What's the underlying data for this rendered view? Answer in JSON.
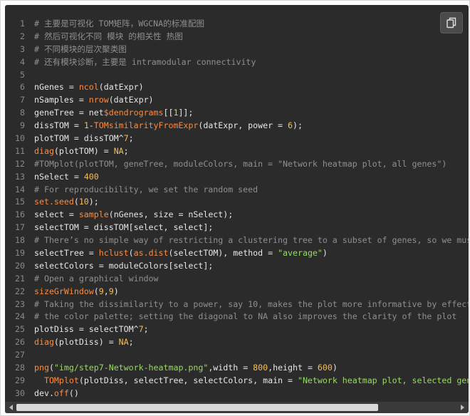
{
  "toolbar": {
    "copy_icon": "copy-icon"
  },
  "code": {
    "lines": [
      {
        "n": "1",
        "t": [
          {
            "c": "c",
            "v": "# 主要是可视化 TOM矩阵，WGCNA的标准配图"
          }
        ]
      },
      {
        "n": "2",
        "t": [
          {
            "c": "c",
            "v": "# 然后可视化不同 模块 的相关性 热图"
          }
        ]
      },
      {
        "n": "3",
        "t": [
          {
            "c": "c",
            "v": "# 不同模块的层次聚类图"
          }
        ]
      },
      {
        "n": "4",
        "t": [
          {
            "c": "c",
            "v": "# 还有模块诊断，主要是 intramodular connectivity"
          }
        ]
      },
      {
        "n": "5",
        "t": []
      },
      {
        "n": "6",
        "t": [
          {
            "c": "",
            "v": "nGenes = "
          },
          {
            "c": "f",
            "v": "ncol"
          },
          {
            "c": "",
            "v": "(datExpr)"
          }
        ]
      },
      {
        "n": "7",
        "t": [
          {
            "c": "",
            "v": "nSamples = "
          },
          {
            "c": "f",
            "v": "nrow"
          },
          {
            "c": "",
            "v": "(datExpr)"
          }
        ]
      },
      {
        "n": "8",
        "t": [
          {
            "c": "",
            "v": "geneTree = net"
          },
          {
            "c": "f",
            "v": "$dendrograms"
          },
          {
            "c": "",
            "v": "[["
          },
          {
            "c": "n",
            "v": "1"
          },
          {
            "c": "",
            "v": "]];"
          }
        ]
      },
      {
        "n": "9",
        "t": [
          {
            "c": "",
            "v": "dissTOM = "
          },
          {
            "c": "n",
            "v": "1"
          },
          {
            "c": "",
            "v": "-"
          },
          {
            "c": "f",
            "v": "TOMsimilarityFromExpr"
          },
          {
            "c": "",
            "v": "(datExpr, power = "
          },
          {
            "c": "n",
            "v": "6"
          },
          {
            "c": "",
            "v": ");"
          }
        ]
      },
      {
        "n": "10",
        "t": [
          {
            "c": "",
            "v": "plotTOM = dissTOM^"
          },
          {
            "c": "n",
            "v": "7"
          },
          {
            "c": "",
            "v": ";"
          }
        ]
      },
      {
        "n": "11",
        "t": [
          {
            "c": "f",
            "v": "diag"
          },
          {
            "c": "",
            "v": "(plotTOM) = "
          },
          {
            "c": "n",
            "v": "NA"
          },
          {
            "c": "",
            "v": ";"
          }
        ]
      },
      {
        "n": "12",
        "t": [
          {
            "c": "c",
            "v": "#TOMplot(plotTOM, geneTree, moduleColors, main = \"Network heatmap plot, all genes\")"
          }
        ]
      },
      {
        "n": "13",
        "t": [
          {
            "c": "",
            "v": "nSelect = "
          },
          {
            "c": "n",
            "v": "400"
          }
        ]
      },
      {
        "n": "14",
        "t": [
          {
            "c": "c",
            "v": "# For reproducibility, we set the random seed"
          }
        ]
      },
      {
        "n": "15",
        "t": [
          {
            "c": "f",
            "v": "set.seed"
          },
          {
            "c": "",
            "v": "("
          },
          {
            "c": "n",
            "v": "10"
          },
          {
            "c": "",
            "v": ");"
          }
        ]
      },
      {
        "n": "16",
        "t": [
          {
            "c": "",
            "v": "select = "
          },
          {
            "c": "f",
            "v": "sample"
          },
          {
            "c": "",
            "v": "(nGenes, size = nSelect);"
          }
        ]
      },
      {
        "n": "17",
        "t": [
          {
            "c": "",
            "v": "selectTOM = dissTOM[select, select];"
          }
        ]
      },
      {
        "n": "18",
        "t": [
          {
            "c": "c",
            "v": "# There’s no simple way of restricting a clustering tree to a subset of genes, so we mus"
          }
        ]
      },
      {
        "n": "19",
        "t": [
          {
            "c": "",
            "v": "selectTree = "
          },
          {
            "c": "f",
            "v": "hclust"
          },
          {
            "c": "",
            "v": "("
          },
          {
            "c": "f",
            "v": "as.dist"
          },
          {
            "c": "",
            "v": "(selectTOM), method = "
          },
          {
            "c": "s",
            "v": "\"average\""
          },
          {
            "c": "",
            "v": ")"
          }
        ]
      },
      {
        "n": "20",
        "t": [
          {
            "c": "",
            "v": "selectColors = moduleColors[select];"
          }
        ]
      },
      {
        "n": "21",
        "t": [
          {
            "c": "c",
            "v": "# Open a graphical window"
          }
        ]
      },
      {
        "n": "22",
        "t": [
          {
            "c": "f",
            "v": "sizeGrWindow"
          },
          {
            "c": "",
            "v": "("
          },
          {
            "c": "n",
            "v": "9"
          },
          {
            "c": "",
            "v": ","
          },
          {
            "c": "n",
            "v": "9"
          },
          {
            "c": "",
            "v": ")"
          }
        ]
      },
      {
        "n": "23",
        "t": [
          {
            "c": "c",
            "v": "# Taking the dissimilarity to a power, say 10, makes the plot more informative by effect"
          }
        ]
      },
      {
        "n": "24",
        "t": [
          {
            "c": "c",
            "v": "# the color palette; setting the diagonal to NA also improves the clarity of the plot"
          }
        ]
      },
      {
        "n": "25",
        "t": [
          {
            "c": "",
            "v": "plotDiss = selectTOM^"
          },
          {
            "c": "n",
            "v": "7"
          },
          {
            "c": "",
            "v": ";"
          }
        ]
      },
      {
        "n": "26",
        "t": [
          {
            "c": "f",
            "v": "diag"
          },
          {
            "c": "",
            "v": "(plotDiss) = "
          },
          {
            "c": "n",
            "v": "NA"
          },
          {
            "c": "",
            "v": ";"
          }
        ]
      },
      {
        "n": "27",
        "t": []
      },
      {
        "n": "28",
        "t": [
          {
            "c": "f",
            "v": "png"
          },
          {
            "c": "",
            "v": "("
          },
          {
            "c": "s",
            "v": "\"img/step7-Network-heatmap.png\""
          },
          {
            "c": "",
            "v": ",width = "
          },
          {
            "c": "n",
            "v": "800"
          },
          {
            "c": "",
            "v": ",height = "
          },
          {
            "c": "n",
            "v": "600"
          },
          {
            "c": "",
            "v": ")"
          }
        ]
      },
      {
        "n": "29",
        "t": [
          {
            "c": "",
            "v": "  "
          },
          {
            "c": "f",
            "v": "TOMplot"
          },
          {
            "c": "",
            "v": "(plotDiss, selectTree, selectColors, main = "
          },
          {
            "c": "s",
            "v": "\"Network heatmap plot, selected gen"
          }
        ]
      },
      {
        "n": "30",
        "t": [
          {
            "c": "",
            "v": "dev."
          },
          {
            "c": "f",
            "v": "off"
          },
          {
            "c": "",
            "v": "()"
          }
        ]
      }
    ]
  },
  "scrollbar": {
    "position_fraction": 0.0,
    "visible_fraction": 0.82
  }
}
